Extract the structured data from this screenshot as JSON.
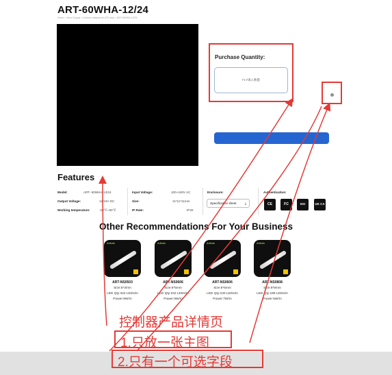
{
  "product": {
    "title": "ART-60WHA-12/24",
    "breadcrumb": "Home > Neon Supply > Outdoor waterproof LED strip > ART-60WHA-12/24"
  },
  "purchase": {
    "label": "Purchase Quantity:",
    "input_text": "FLY填入数量"
  },
  "features": {
    "title": "Features",
    "col1": [
      {
        "key": "Model:",
        "value": "ART- 60WHA-12/24"
      },
      {
        "key": "Output Voltage:",
        "value": "12/24V DC"
      },
      {
        "key": "Working temperature:",
        "value": "-20℃~60℃"
      }
    ],
    "col2": [
      {
        "key": "Input Voltage:",
        "value": "100~240V AC"
      },
      {
        "key": "Size:",
        "value": "11*11*11mm"
      },
      {
        "key": "IP Rate:",
        "value": "IP20"
      }
    ],
    "enclosure_label": "Enclosure:",
    "spec_button": "Specification sheet",
    "auth_label": "Authentication:",
    "certs": [
      "CE",
      "FC",
      "ISO",
      "UK CA"
    ]
  },
  "recommendations": {
    "title": "Other Recommendations For Your Business",
    "brand": "Artleds",
    "items": [
      {
        "name": "ART-NS0503",
        "size": "Size:5*3mm",
        "led": "LED Qty:322 LEDs/m",
        "power": "Power:9W/m"
      },
      {
        "name": "ART-NS0606",
        "size": "Size:6*5mm",
        "led": "LED Qty:322 LEDs/m",
        "power": "Power:9W/m"
      },
      {
        "name": "ART-NS0606",
        "size": "Size:6*6mm",
        "led": "LED Qty:240 LEDs/m",
        "power": "Power:7W/m"
      },
      {
        "name": "ART-NS0808",
        "size": "Size:8*8mm",
        "led": "LED Qty:188 LEDs/m",
        "power": "Power:5W/m"
      }
    ]
  },
  "annotations": {
    "heading": "控制器产品详情页",
    "point1": "1.只放一张主图",
    "point2": "2.只有一个可选字段",
    "color": "#e53935"
  },
  "colors": {
    "accent_button": "#2565d2",
    "annotation_red": "#e53935"
  }
}
